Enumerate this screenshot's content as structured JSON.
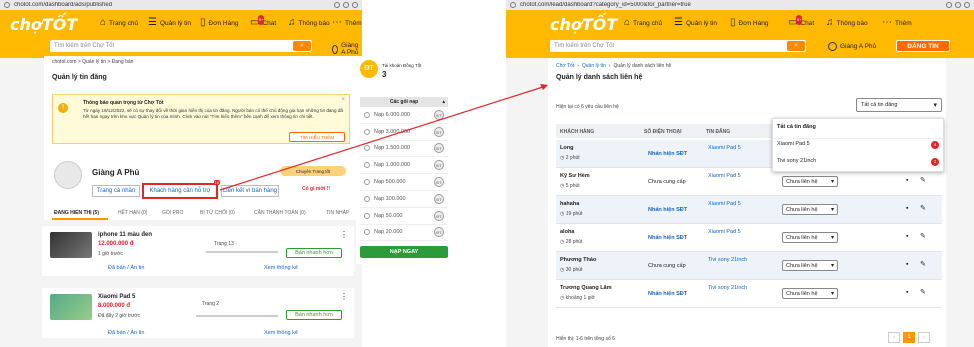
{
  "left": {
    "url": "chotot.com/dashboard/ads/published",
    "logo": "chợTỐT",
    "nav": [
      "Trang chủ",
      "Quản lý tin",
      "Đơn Hàng",
      "Chat",
      "Thông báo",
      "Thêm"
    ],
    "chat_badge": "9+",
    "search_placeholder": "Tìm kiếm trên Chợ Tốt",
    "user": "Giàng A Phủ",
    "post_btn": "ĐĂNG TIN",
    "breadcrumb": "chotot.com > Quản lý tin > Đang bán",
    "page_title": "Quản lý tin đăng",
    "notice_title": "Thông báo quan trọng từ Chợ Tốt",
    "notice_body": "Từ ngày 19/12/2022, sẽ có sự thay đổi về thời gian hiển thị của tin đăng. Người bán có thể chủ động gia hạn những tin đang đã hết hạn ngay trên khu vực Quản lý tin của mình. Click vào nút \"Tìm hiểu thêm\" bên cạnh để xem thông tin chi tiết.",
    "notice_btn": "TÌM HIỂU THÊM",
    "profile_name": "Giàng A Phủ",
    "btn_personal": "Trang cá nhân",
    "btn_support": "Khách hàng cần hỗ trợ",
    "btn_support_badge": "10",
    "btn_link": "Liên kết ví bán hàng",
    "pro_badge": "Chuyên Trang tốt",
    "new_badge": "Có gì mới !!",
    "tabs": [
      "ĐANG HIỂN THỊ (5)",
      "HẾT HẠN (0)",
      "GÓI PRO",
      "BỊ TỪ CHỐI (0)",
      "CẦN THANH TOÁN (0)",
      "TIN NHÁP"
    ],
    "account_label": "Tài khoản Đồng Tốt",
    "account_value": "3",
    "pkg_header": "Các gói nạp",
    "packages": [
      "Nạp 6.000.000",
      "Nạp 3.000.000",
      "Nạp 1.500.000",
      "Nạp 1.000.000",
      "Nạp 500.000",
      "Nạp 100.000",
      "Nạp 50.000",
      "Nạp 20.000"
    ],
    "topup_btn": "NẠP NGAY",
    "listings": [
      {
        "title": "iphone 11 màu đen",
        "price": "12.000.000 đ",
        "time": "1 giờ trước",
        "tier": "Trang 13",
        "sell": "Bán nhanh hơn",
        "sold": "Đã bán / Ẩn tin",
        "stats": "Xem thống kê"
      },
      {
        "title": "Xiaomi Pad 5",
        "price": "8.000.000 đ",
        "time": "Đã đẩy 2 giờ trước",
        "tier": "Trang 2",
        "sell": "Bán nhanh hơn",
        "sold": "Đã bán / Ẩn tin",
        "stats": "Xem thống kê"
      }
    ]
  },
  "right": {
    "url": "chotot.com/lead/dashboard?category_id=5000&for_partner=true",
    "breadcrumb": [
      "Chợ Tốt",
      "Quản lý tin",
      "Quản lý danh sách liên hệ"
    ],
    "page_title": "Quản lý danh sách liên hệ",
    "summary": "Hiện tại có 6 yêu cầu liên hệ",
    "filter": "Tất cả tin đăng",
    "dropdown_header": "Tất cả tin đăng",
    "dropdown_items": [
      {
        "label": "Xiaomi Pad 5",
        "count": "4"
      },
      {
        "label": "Tivi sony 21inch",
        "count": "1"
      }
    ],
    "columns": [
      "KHÁCH HÀNG",
      "SỐ ĐIỆN THOẠI",
      "TIN ĐĂNG"
    ],
    "rows": [
      {
        "name": "Long",
        "time": "2 phút",
        "phone": "Nhấn hiện SĐT",
        "ad": "Xiaomi Pad 5",
        "status": ""
      },
      {
        "name": "Kỹ Sư Hèm",
        "time": "5 phút",
        "phone": "Chưa cung cấp",
        "ad": "Xiaomi Pad 5",
        "status": "Chưa liên hệ"
      },
      {
        "name": "hahaha",
        "time": "19 phút",
        "phone": "Nhấn hiện SĐT",
        "ad": "Xiaomi Pad 5",
        "status": "Chưa liên hệ"
      },
      {
        "name": "aloha",
        "time": "28 phút",
        "phone": "Nhấn hiện SĐT",
        "ad": "Xiaomi Pad 5",
        "status": "Chưa liên hệ"
      },
      {
        "name": "Phương Thảo",
        "time": "30 phút",
        "phone": "Chưa cung cấp",
        "ad": "Tivi sony 21inch",
        "status": "Chưa liên hệ"
      },
      {
        "name": "Trương Quang Lâm",
        "time": "khoảng 1 giờ",
        "phone": "Nhấn hiện SĐT",
        "ad": "Tivi sony 21inch",
        "status": "Chưa liên hệ"
      }
    ],
    "footer": "Hiển thị: 1-6 trên tổng số 6",
    "page": "1"
  },
  "colors": {
    "brand": "#ffba00",
    "accent": "#ff6b00",
    "link": "#1565c0",
    "annotation": "#e0252b"
  }
}
